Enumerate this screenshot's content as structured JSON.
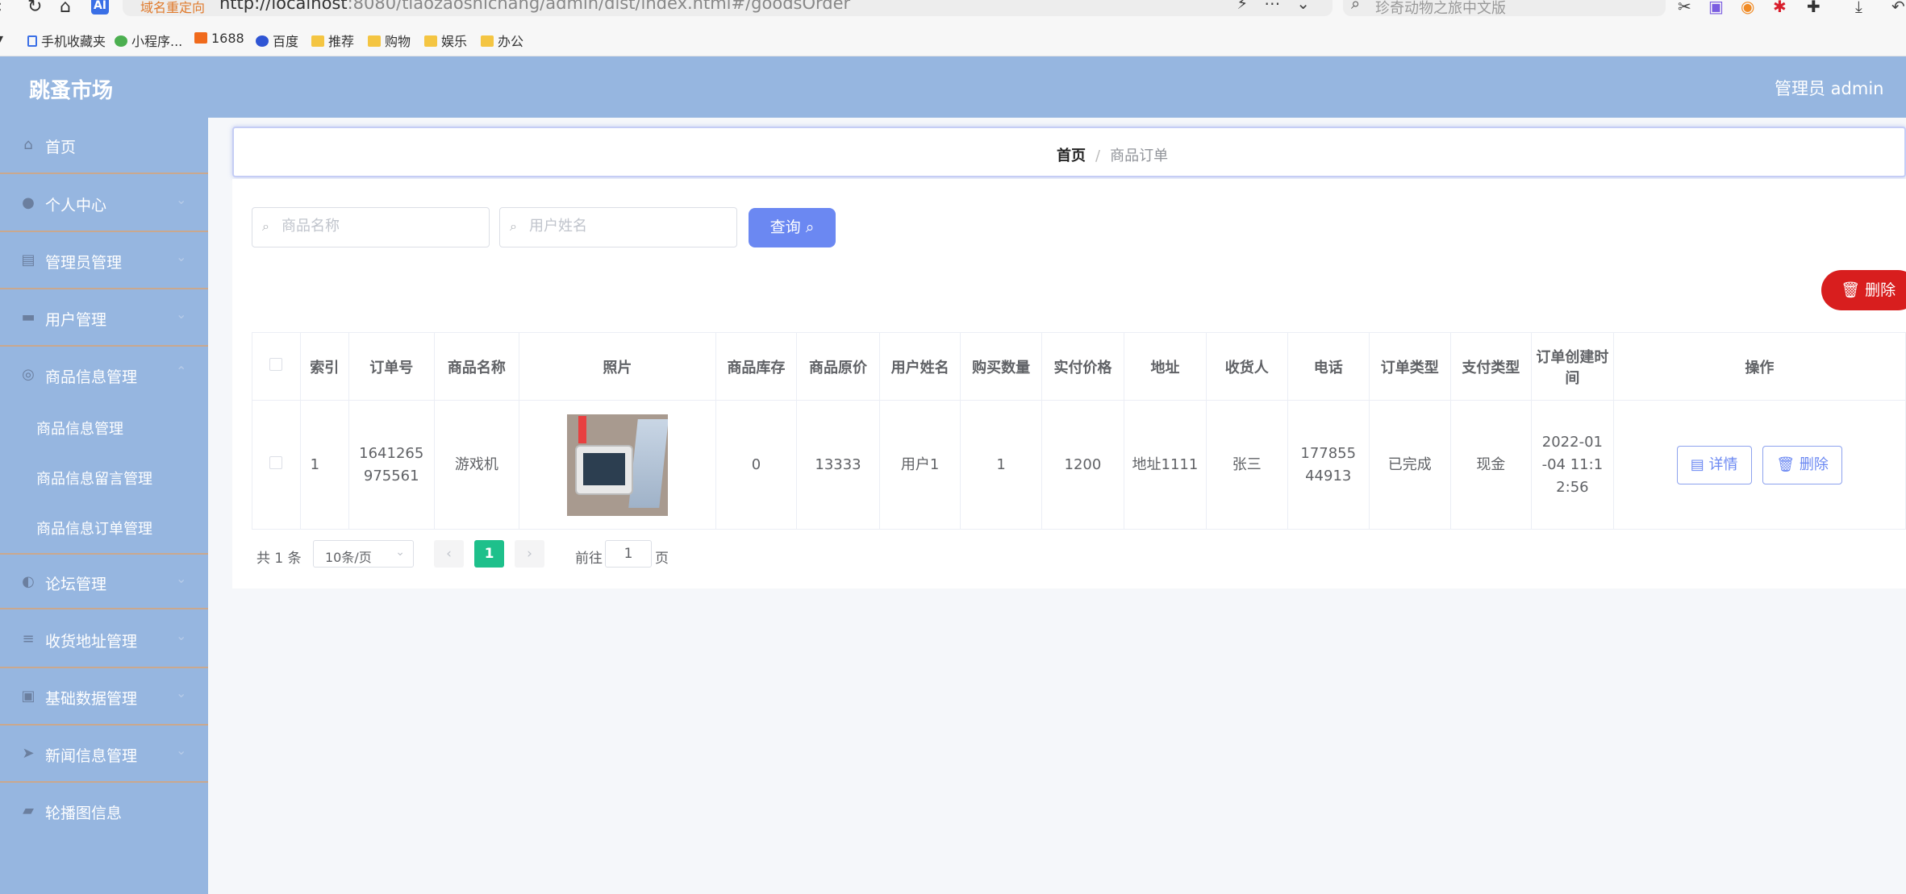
{
  "browser": {
    "redirect_label": "域名重定向",
    "url_host": "http://localhost",
    "url_rest": ":8080/tiaozaoshichang/admin/dist/index.html#/goodsOrder",
    "search_text": "珍奇动物之旅中文版",
    "ai_badge": "AI",
    "bookmarks": [
      "手机收藏夹",
      "小程序...",
      "1688",
      "百度",
      "推荐",
      "购物",
      "娱乐",
      "办公"
    ]
  },
  "header": {
    "brand": "跳蚤市场",
    "admin": "管理员 admin"
  },
  "sidebar": {
    "items": [
      {
        "label": "首页"
      },
      {
        "label": "个人中心"
      },
      {
        "label": "管理员管理"
      },
      {
        "label": "用户管理"
      },
      {
        "label": "商品信息管理"
      },
      {
        "label": "论坛管理"
      },
      {
        "label": "收货地址管理"
      },
      {
        "label": "基础数据管理"
      },
      {
        "label": "新闻信息管理"
      },
      {
        "label": "轮播图信息"
      }
    ],
    "subitems": [
      "商品信息管理",
      "商品信息留言管理",
      "商品信息订单管理"
    ]
  },
  "breadcrumb": {
    "home": "首页",
    "separator": "/",
    "current": "商品订单"
  },
  "search": {
    "goods_placeholder": "商品名称",
    "user_placeholder": "用户姓名",
    "query_label": "查询",
    "delete_label": "删除"
  },
  "table": {
    "headers": [
      "索引",
      "订单号",
      "商品名称",
      "照片",
      "商品库存",
      "商品原价",
      "用户姓名",
      "购买数量",
      "实付价格",
      "地址",
      "收货人",
      "电话",
      "订单类型",
      "支付类型",
      "订单创建时间",
      "操作"
    ],
    "rows": [
      {
        "index": "1",
        "order_no": "1641265975561",
        "goods_name": "游戏机",
        "stock": "0",
        "original_price": "13333",
        "user_name": "用户1",
        "quantity": "1",
        "paid": "1200",
        "address": "地址1111",
        "receiver": "张三",
        "phone": "17785544913",
        "order_type": "已完成",
        "pay_type": "现金",
        "created": "2022-01-04 11:12:56",
        "detail_label": "详情",
        "delete_label": "删除"
      }
    ]
  },
  "pagination": {
    "total": "共 1 条",
    "page_size": "10条/页",
    "current_page": "1",
    "goto_label": "前往",
    "goto_value": "1",
    "page_unit": "页"
  }
}
